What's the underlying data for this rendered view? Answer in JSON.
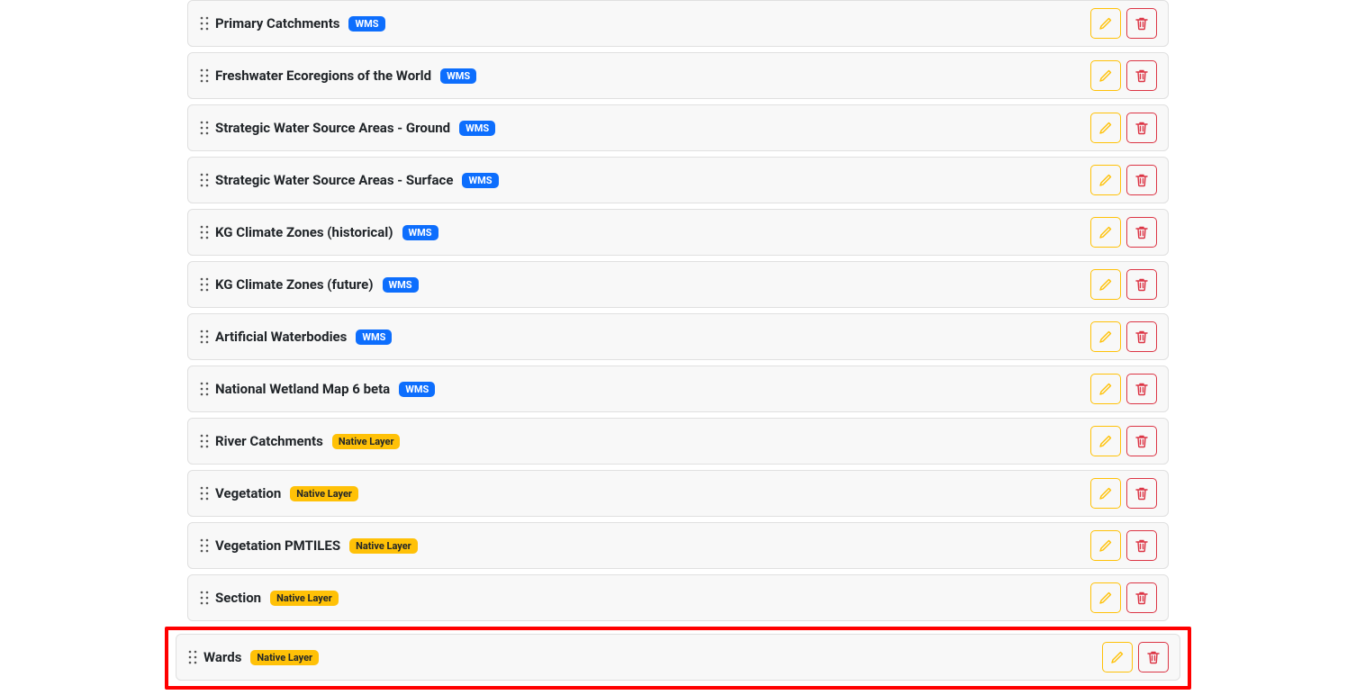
{
  "badges": {
    "wms": "WMS",
    "native": "Native Layer"
  },
  "layers": [
    {
      "name": "Primary Catchments",
      "type": "wms",
      "highlighted": false
    },
    {
      "name": "Freshwater Ecoregions of the World",
      "type": "wms",
      "highlighted": false
    },
    {
      "name": "Strategic Water Source Areas - Ground",
      "type": "wms",
      "highlighted": false
    },
    {
      "name": "Strategic Water Source Areas - Surface",
      "type": "wms",
      "highlighted": false
    },
    {
      "name": "KG Climate Zones (historical)",
      "type": "wms",
      "highlighted": false
    },
    {
      "name": "KG Climate Zones (future)",
      "type": "wms",
      "highlighted": false
    },
    {
      "name": "Artificial Waterbodies",
      "type": "wms",
      "highlighted": false
    },
    {
      "name": "National Wetland Map 6 beta",
      "type": "wms",
      "highlighted": false
    },
    {
      "name": "River Catchments",
      "type": "native",
      "highlighted": false
    },
    {
      "name": "Vegetation",
      "type": "native",
      "highlighted": false
    },
    {
      "name": "Vegetation PMTILES",
      "type": "native",
      "highlighted": false
    },
    {
      "name": "Section",
      "type": "native",
      "highlighted": false
    },
    {
      "name": "Wards",
      "type": "native",
      "highlighted": true
    }
  ]
}
